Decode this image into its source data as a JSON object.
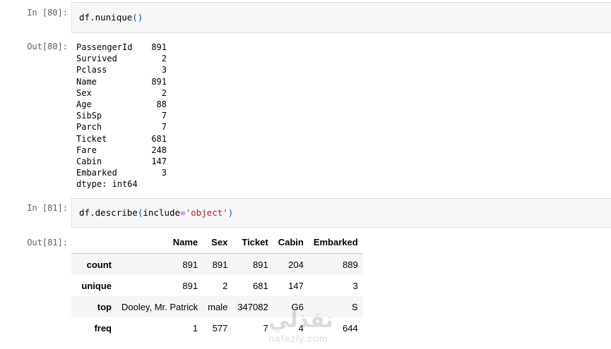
{
  "cells": [
    {
      "in_prompt": "In [80]:",
      "code": {
        "obj": "df",
        "dot": ".",
        "method": "nunique",
        "lparen": "(",
        "rparen": ")"
      },
      "out_prompt": "Out[80]:",
      "series": [
        {
          "key": "PassengerId",
          "value": "891"
        },
        {
          "key": "Survived",
          "value": "2"
        },
        {
          "key": "Pclass",
          "value": "3"
        },
        {
          "key": "Name",
          "value": "891"
        },
        {
          "key": "Sex",
          "value": "2"
        },
        {
          "key": "Age",
          "value": "88"
        },
        {
          "key": "SibSp",
          "value": "7"
        },
        {
          "key": "Parch",
          "value": "7"
        },
        {
          "key": "Ticket",
          "value": "681"
        },
        {
          "key": "Fare",
          "value": "248"
        },
        {
          "key": "Cabin",
          "value": "147"
        },
        {
          "key": "Embarked",
          "value": "3"
        }
      ],
      "dtype": "dtype: int64"
    },
    {
      "in_prompt": "In [81]:",
      "code": {
        "obj": "df",
        "dot": ".",
        "method": "describe",
        "lparen": "(",
        "kwarg": "include",
        "eq": "=",
        "str": "'object'",
        "rparen": ")"
      },
      "out_prompt": "Out[81]:",
      "table": {
        "columns": [
          "Name",
          "Sex",
          "Ticket",
          "Cabin",
          "Embarked"
        ],
        "rows": [
          {
            "index": "count",
            "values": [
              "891",
              "891",
              "891",
              "204",
              "889"
            ]
          },
          {
            "index": "unique",
            "values": [
              "891",
              "2",
              "681",
              "147",
              "3"
            ]
          },
          {
            "index": "top",
            "values": [
              "Dooley, Mr. Patrick",
              "male",
              "347082",
              "G6",
              "S"
            ]
          },
          {
            "index": "freq",
            "values": [
              "1",
              "577",
              "7",
              "4",
              "644"
            ]
          }
        ]
      }
    }
  ],
  "watermark": {
    "logo": "نفذلي",
    "text": "nafezly.com"
  }
}
